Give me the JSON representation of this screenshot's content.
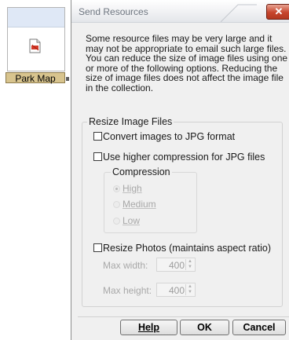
{
  "background": {
    "thumbnail_label": "Park Map"
  },
  "dialog": {
    "title": "Send Resources",
    "close_glyph": "✕",
    "intro": "Some resource files may be very large and it may not be appropriate to email such large files. You can reduce the size of image files using one or more of the following options. Reducing the size of image files does not affect the image file in the collection.",
    "resize_group": {
      "legend": "Resize Image Files",
      "convert_jpg": {
        "label": "Convert images to JPG format",
        "checked": false
      },
      "higher_compression": {
        "label": "Use higher compression for JPG files",
        "checked": false
      },
      "compression": {
        "legend": "Compression",
        "options": [
          {
            "label": "High",
            "selected": true,
            "enabled": false
          },
          {
            "label": "Medium",
            "selected": false,
            "enabled": false
          },
          {
            "label": "Low",
            "selected": false,
            "enabled": false
          }
        ]
      },
      "resize_photos": {
        "label": "Resize Photos (maintains aspect ratio)",
        "checked": false
      },
      "max_width": {
        "label": "Max width:",
        "value": "400"
      },
      "max_height": {
        "label": "Max height:",
        "value": "400"
      }
    },
    "buttons": {
      "help": "Help",
      "ok": "OK",
      "cancel": "Cancel"
    }
  },
  "colors": {
    "dialog_bg": "#f0f0f0",
    "close_button": "#c7452d",
    "thumbnail_label_bg": "#d8c48e",
    "disabled_text": "#a8a8a8"
  },
  "icons": {
    "thumbnail": "pdf-document-icon",
    "close": "close-icon"
  }
}
